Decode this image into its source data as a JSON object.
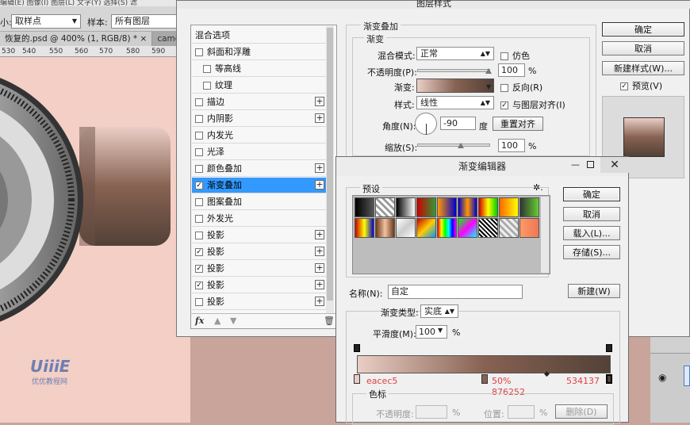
{
  "ps": {
    "menubar": "编辑(E)   图像(I)   图层(L)   文字(Y)   选择(S)   滤",
    "opt_label": "小:",
    "sample_size": "取样点",
    "sample_label": "样本:",
    "sample_value": "所有图层",
    "tab1": "恢复的.psd @ 400% (1, RGB/8) *",
    "tab1_close": "×",
    "tab2": "camera-p.psd",
    "ruler": [
      "530",
      "540",
      "550",
      "560",
      "570",
      "580",
      "590"
    ],
    "watermark": "UiiiE",
    "watermark_sub": "优优教程网"
  },
  "layer_style": {
    "title": "图层样式",
    "styles": [
      {
        "label": "混合选项",
        "checkbox": false,
        "checked": false,
        "plus": false,
        "indent": false
      },
      {
        "label": "斜面和浮雕",
        "checkbox": true,
        "checked": false,
        "plus": false,
        "indent": false
      },
      {
        "label": "等高线",
        "checkbox": true,
        "checked": false,
        "plus": false,
        "indent": true
      },
      {
        "label": "纹理",
        "checkbox": true,
        "checked": false,
        "plus": false,
        "indent": true
      },
      {
        "label": "描边",
        "checkbox": true,
        "checked": false,
        "plus": true,
        "indent": false
      },
      {
        "label": "内阴影",
        "checkbox": true,
        "checked": false,
        "plus": true,
        "indent": false
      },
      {
        "label": "内发光",
        "checkbox": true,
        "checked": false,
        "plus": false,
        "indent": false
      },
      {
        "label": "光泽",
        "checkbox": true,
        "checked": false,
        "plus": false,
        "indent": false
      },
      {
        "label": "颜色叠加",
        "checkbox": true,
        "checked": false,
        "plus": true,
        "indent": false
      },
      {
        "label": "渐变叠加",
        "checkbox": true,
        "checked": true,
        "plus": true,
        "indent": false,
        "selected": true
      },
      {
        "label": "图案叠加",
        "checkbox": true,
        "checked": false,
        "plus": false,
        "indent": false
      },
      {
        "label": "外发光",
        "checkbox": true,
        "checked": false,
        "plus": false,
        "indent": false
      },
      {
        "label": "投影",
        "checkbox": true,
        "checked": false,
        "plus": true,
        "indent": false
      },
      {
        "label": "投影",
        "checkbox": true,
        "checked": true,
        "plus": true,
        "indent": false
      },
      {
        "label": "投影",
        "checkbox": true,
        "checked": true,
        "plus": true,
        "indent": false
      },
      {
        "label": "投影",
        "checkbox": true,
        "checked": true,
        "plus": true,
        "indent": false
      },
      {
        "label": "投影",
        "checkbox": true,
        "checked": false,
        "plus": true,
        "indent": false
      }
    ],
    "fx": "fx",
    "section_title": "渐变叠加",
    "group_title": "渐变",
    "blend_label": "混合模式:",
    "blend_value": "正常",
    "dither_label": "仿色",
    "opacity_label": "不透明度(P):",
    "opacity_value": "100",
    "pct": "%",
    "gradient_label": "渐变:",
    "reverse_label": "反向(R)",
    "style_label": "样式:",
    "style_value": "线性",
    "align_label": "与图层对齐(I)",
    "angle_label": "角度(N):",
    "angle_value": "-90",
    "degree": "度",
    "reset_align": "重置对齐",
    "scale_label": "缩放(S):",
    "scale_value": "100",
    "ok": "确定",
    "cancel": "取消",
    "new_style": "新建样式(W)...",
    "preview": "预览(V)"
  },
  "grad_editor": {
    "title": "渐变编辑器",
    "presets": "预设",
    "gear": "✲.",
    "ok": "确定",
    "cancel": "取消",
    "load": "载入(L)...",
    "save": "存储(S)...",
    "name_label": "名称(N):",
    "name_value": "自定",
    "new": "新建(W)",
    "type_label": "渐变类型:",
    "type_value": "实底",
    "smooth_label": "平滑度(M):",
    "smooth_value": "100",
    "pct": "%",
    "stop_left": "eacec5",
    "stop_mid_pct": "50%",
    "stop_mid_color": "876252",
    "stop_right": "534137",
    "stops_title": "色标",
    "stop_opacity_label": "不透明度:",
    "stop_opacity_pct": "%",
    "location_label": "位置:",
    "location_pct": "%",
    "delete": "删除(D)"
  },
  "colors": {
    "grad_start": "#eacec5",
    "grad_mid": "#876252",
    "grad_end": "#534137",
    "selection": "#3399ff",
    "stop_text": "#e04040"
  }
}
